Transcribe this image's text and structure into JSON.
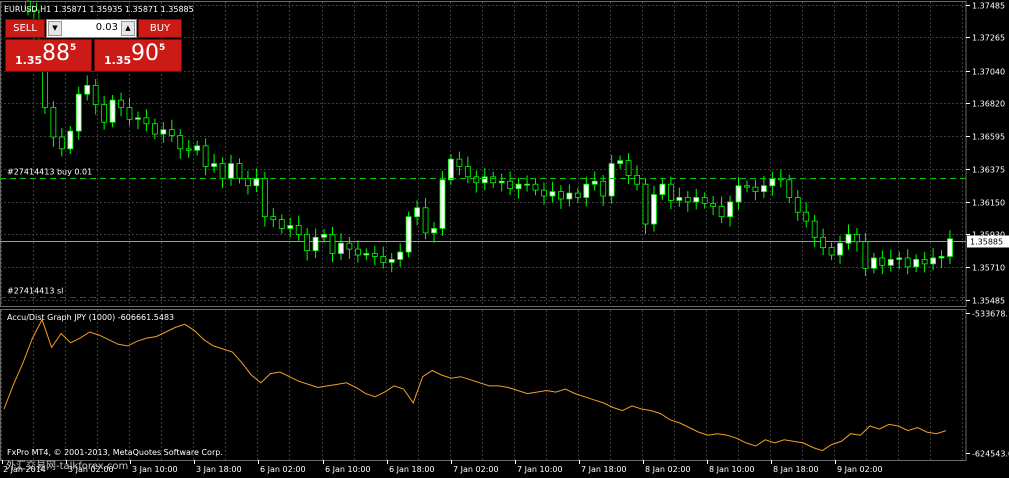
{
  "header": {
    "symbol_line": "EURUSD,H1  1.35871 1.35935 1.35871 1.35885"
  },
  "trade_panel": {
    "sell_label": "SELL",
    "buy_label": "BUY",
    "lot_value": "0.03",
    "sell_price": {
      "prefix": "1.35",
      "big": "88",
      "sup": "5"
    },
    "buy_price": {
      "prefix": "1.35",
      "big": "90",
      "sup": "5"
    },
    "sell_color": "#cc1a16"
  },
  "orders": [
    {
      "label": "#27414413 buy 0.01",
      "price": 1.3631,
      "color": "#00c000"
    },
    {
      "label": "#27414413 sl",
      "price": 1.35505,
      "color": "#e00000"
    }
  ],
  "indicator": {
    "label": "Accu/Dist Graph JPY (1000) -606661.5483"
  },
  "footer": {
    "copyright": "FxPro MT4, © 2001-2013, MetaQuotes Software Corp.",
    "watermark": "外汇交易网-talkforex.com"
  },
  "colors": {
    "bull": "#ffffff",
    "bear": "#000000",
    "candle_outline": "#00ff00",
    "ad_line": "#f0a020",
    "grid": "#3c3c3c"
  },
  "chart_data": [
    {
      "type": "candlestick",
      "title": "EURUSD,H1",
      "ylim": [
        1.35485,
        1.37485
      ],
      "y_ticks": [
        "1.37485",
        "1.37265",
        "1.37040",
        "1.36820",
        "1.36595",
        "1.36375",
        "1.36150",
        "1.35930",
        "1.35710",
        "1.35485"
      ],
      "current_price": "1.35885",
      "x_ticks": [
        "2 Jan 2014",
        "3 Jan 02:00",
        "3 Jan 10:00",
        "3 Jan 18:00",
        "6 Jan 02:00",
        "6 Jan 10:00",
        "6 Jan 18:00",
        "7 Jan 02:00",
        "7 Jan 10:00",
        "7 Jan 18:00",
        "8 Jan 02:00",
        "8 Jan 10:00",
        "8 Jan 18:00",
        "9 Jan 02:00"
      ],
      "grid": true,
      "closes": [
        1.3745,
        1.3718,
        1.3679,
        1.3659,
        1.3651,
        1.3663,
        1.3688,
        1.3694,
        1.3681,
        1.3669,
        1.3684,
        1.3679,
        1.3671,
        1.3672,
        1.3668,
        1.3661,
        1.3664,
        1.366,
        1.3651,
        1.365,
        1.3653,
        1.3639,
        1.3641,
        1.3631,
        1.3641,
        1.3631,
        1.3626,
        1.3631,
        1.3605,
        1.3603,
        1.3597,
        1.3599,
        1.3593,
        1.3582,
        1.3591,
        1.3593,
        1.358,
        1.3587,
        1.3583,
        1.3579,
        1.358,
        1.3578,
        1.3574,
        1.3576,
        1.3581,
        1.3605,
        1.3611,
        1.3594,
        1.3597,
        1.363,
        1.3644,
        1.3639,
        1.3632,
        1.3628,
        1.3632,
        1.3628,
        1.3629,
        1.3624,
        1.3627,
        1.3627,
        1.3623,
        1.3619,
        1.3622,
        1.3617,
        1.3621,
        1.3618,
        1.3627,
        1.3629,
        1.3619,
        1.3641,
        1.3643,
        1.3633,
        1.3627,
        1.36,
        1.362,
        1.3627,
        1.3616,
        1.3618,
        1.3615,
        1.3618,
        1.3614,
        1.3612,
        1.3605,
        1.3615,
        1.3626,
        1.3625,
        1.3622,
        1.3626,
        1.3631,
        1.363,
        1.3618,
        1.3608,
        1.3602,
        1.3591,
        1.3584,
        1.3579,
        1.3587,
        1.3593,
        1.3588,
        1.357,
        1.3577,
        1.3572,
        1.3576,
        1.3577,
        1.3571,
        1.3576,
        1.3573,
        1.3577,
        1.3578,
        1.359
      ],
      "ohlc_note": "opens = previous close; wicks estimated"
    },
    {
      "type": "line",
      "title": "Accu/Dist Graph JPY (1000) -606661.5483",
      "ylim": [
        -624543.0,
        -533678.1
      ],
      "y_ticks": [
        "-533678.1",
        "-624543.0"
      ],
      "values": [
        -596000,
        -580000,
        -566000,
        -550000,
        -538000,
        -556000,
        -547000,
        -553000,
        -550000,
        -546000,
        -548000,
        -551000,
        -554000,
        -555000,
        -552000,
        -550000,
        -549000,
        -546000,
        -543000,
        -541000,
        -545000,
        -551000,
        -555000,
        -557000,
        -559000,
        -566000,
        -574000,
        -579000,
        -573000,
        -572000,
        -575000,
        -578000,
        -580000,
        -582000,
        -581000,
        -580000,
        -579000,
        -582000,
        -586000,
        -588000,
        -585000,
        -581000,
        -583000,
        -592000,
        -575000,
        -571000,
        -574000,
        -576000,
        -575000,
        -577000,
        -579000,
        -581000,
        -581000,
        -582000,
        -584000,
        -586000,
        -585000,
        -584000,
        -585000,
        -583000,
        -586000,
        -588000,
        -590000,
        -592000,
        -595000,
        -597000,
        -594000,
        -596000,
        -597000,
        -599000,
        -603000,
        -605000,
        -608000,
        -611000,
        -613000,
        -612000,
        -613000,
        -615000,
        -618000,
        -620000,
        -616000,
        -618000,
        -616000,
        -617000,
        -618000,
        -621000,
        -623000,
        -619000,
        -617000,
        -612000,
        -613000,
        -607000,
        -609000,
        -606000,
        -607000,
        -610000,
        -608000,
        -611000,
        -612000,
        -610000
      ]
    }
  ]
}
